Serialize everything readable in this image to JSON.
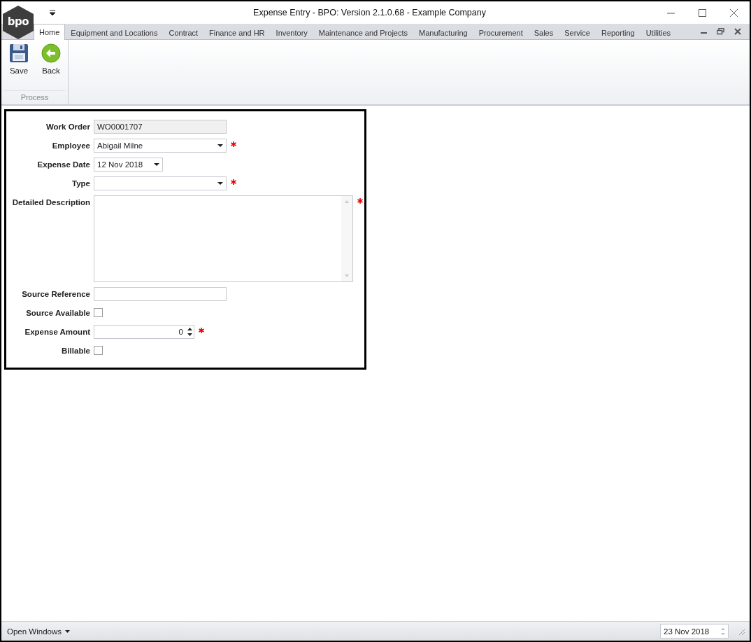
{
  "window": {
    "title": "Expense Entry - BPO: Version 2.1.0.68 - Example Company",
    "logo": "bpo"
  },
  "tabs": [
    {
      "label": "Home",
      "selected": true
    },
    {
      "label": "Equipment and Locations",
      "selected": false
    },
    {
      "label": "Contract",
      "selected": false
    },
    {
      "label": "Finance and HR",
      "selected": false
    },
    {
      "label": "Inventory",
      "selected": false
    },
    {
      "label": "Maintenance and Projects",
      "selected": false
    },
    {
      "label": "Manufacturing",
      "selected": false
    },
    {
      "label": "Procurement",
      "selected": false
    },
    {
      "label": "Sales",
      "selected": false
    },
    {
      "label": "Service",
      "selected": false
    },
    {
      "label": "Reporting",
      "selected": false
    },
    {
      "label": "Utilities",
      "selected": false
    }
  ],
  "ribbon": {
    "group": "Process",
    "buttons": [
      {
        "label": "Save",
        "kind": "save"
      },
      {
        "label": "Back",
        "kind": "back"
      }
    ]
  },
  "form": {
    "fields": [
      {
        "label": "Work Order",
        "kind": "text",
        "value": "WO0001707",
        "read_only": true,
        "required": false
      },
      {
        "label": "Employee",
        "kind": "combo",
        "value": "Abigail Milne",
        "read_only": false,
        "required": true
      },
      {
        "label": "Expense Date",
        "kind": "date",
        "value": "12 Nov 2018",
        "read_only": false,
        "required": false
      },
      {
        "label": "Type",
        "kind": "combo",
        "read_only": false,
        "required": true
      },
      {
        "label": "Detailed Description",
        "kind": "memo",
        "read_only": false,
        "required": true
      },
      {
        "label": "Source Reference",
        "kind": "text",
        "read_only": false,
        "required": false
      },
      {
        "label": "Source Available",
        "kind": "checkbox",
        "checked": false,
        "read_only": false,
        "required": false
      },
      {
        "label": "Expense Amount",
        "kind": "spin",
        "value": "0",
        "read_only": false,
        "required": true
      },
      {
        "label": "Billable",
        "kind": "checkbox",
        "checked": false,
        "read_only": false,
        "required": false
      }
    ]
  },
  "status_bar": {
    "open_windows": "Open Windows",
    "date": "23 Nov 2018"
  }
}
